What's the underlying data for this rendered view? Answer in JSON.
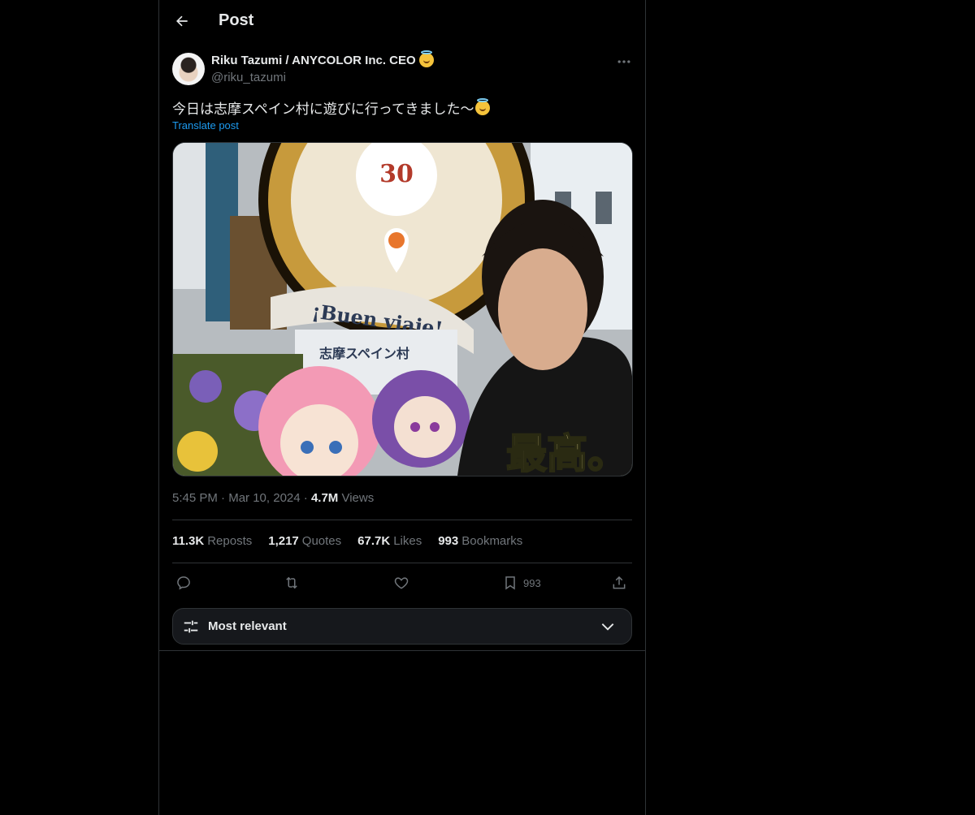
{
  "header": {
    "title": "Post"
  },
  "post": {
    "author_name": "Riku Tazumi / ANYCOLOR Inc. CEO",
    "author_handle": "@riku_tazumi",
    "text": "今日は志摩スペイン村に遊びに行ってきました〜",
    "translate_label": "Translate post",
    "time": "5:45 PM",
    "date": "Mar 10, 2024",
    "views_count": "4.7M",
    "views_label": "Views",
    "media": {
      "sign_text": "¡Buen viaje!",
      "sign_subtext": "志摩スペイン村",
      "overlay_text": "最高。",
      "medallion_text": "30"
    }
  },
  "stats": {
    "reposts_count": "11.3K",
    "reposts_label": "Reposts",
    "quotes_count": "1,217",
    "quotes_label": "Quotes",
    "likes_count": "67.7K",
    "likes_label": "Likes",
    "bookmarks_count": "993",
    "bookmarks_label": "Bookmarks"
  },
  "actions": {
    "bookmark_count": "993",
    "icons": [
      "reply-icon",
      "repost-icon",
      "like-icon",
      "bookmark-icon",
      "share-icon"
    ]
  },
  "sort": {
    "label": "Most relevant"
  },
  "colors": {
    "background": "#000000",
    "text": "#e7e9ea",
    "secondary": "#71767b",
    "link": "#1d9bf0",
    "border": "#2f3336"
  }
}
